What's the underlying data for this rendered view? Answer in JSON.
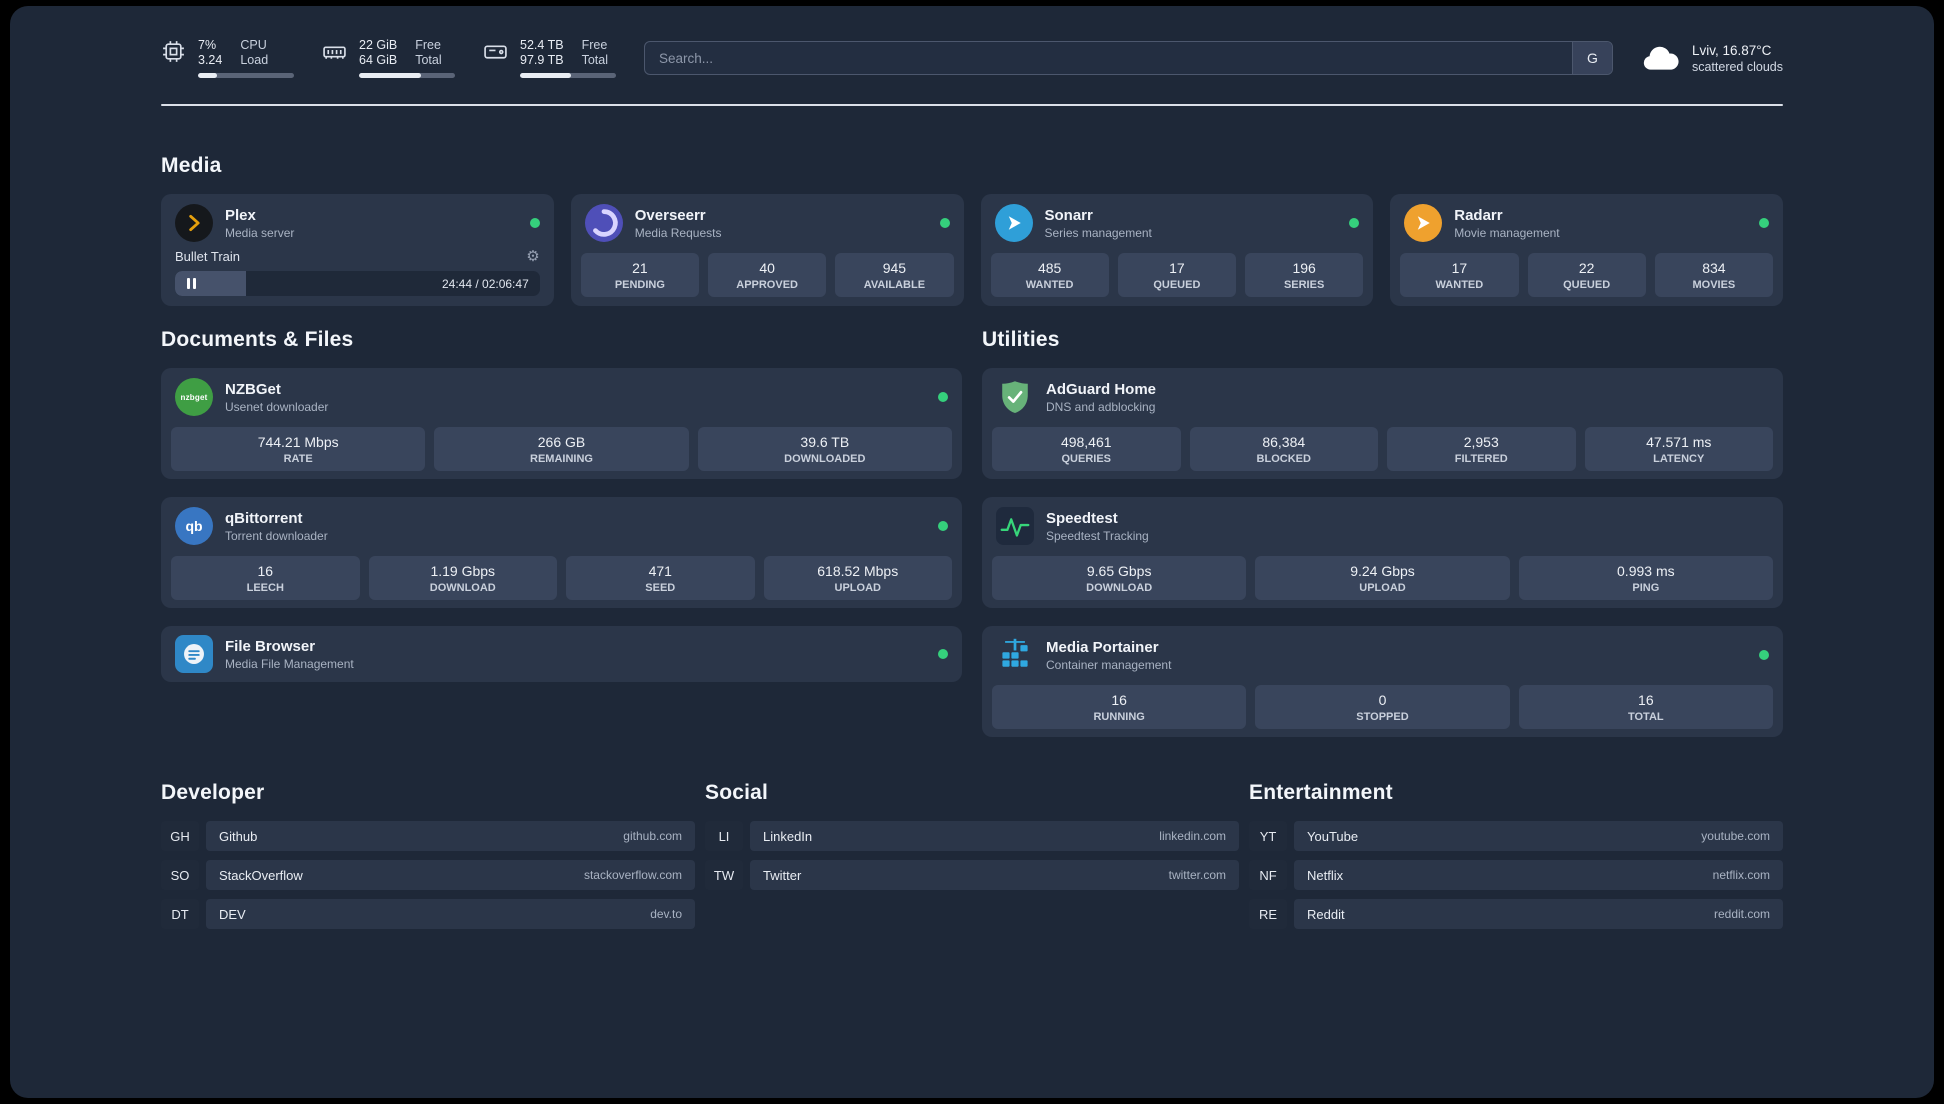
{
  "colors": {
    "status_green": "#35d07c",
    "plex_amber": "#e5a00d",
    "accent_blue": "#2fa8e0"
  },
  "topbar": {
    "cpu": {
      "usage": "7%",
      "load": "3.24",
      "label_top": "CPU",
      "label_bottom": "Load",
      "bar_percent": 20
    },
    "memory": {
      "free": "22 GiB",
      "total": "64 GiB",
      "label_top": "Free",
      "label_bottom": "Total",
      "bar_percent": 65
    },
    "disk": {
      "free": "52.4 TB",
      "total": "97.9 TB",
      "label_top": "Free",
      "label_bottom": "Total",
      "bar_percent": 53
    },
    "search": {
      "placeholder": "Search...",
      "button_label": "G"
    },
    "weather": {
      "location": "Lviv, 16.87°C",
      "condition": "scattered clouds"
    }
  },
  "media": {
    "title": "Media",
    "plex": {
      "name": "Plex",
      "subtitle": "Media server",
      "player": {
        "track_title": "Bullet Train",
        "time": "24:44 / 02:06:47",
        "progress_percent": 19.5
      }
    },
    "overseerr": {
      "name": "Overseerr",
      "subtitle": "Media Requests",
      "stats": [
        {
          "value": "21",
          "label": "PENDING"
        },
        {
          "value": "40",
          "label": "APPROVED"
        },
        {
          "value": "945",
          "label": "AVAILABLE"
        }
      ]
    },
    "sonarr": {
      "name": "Sonarr",
      "subtitle": "Series management",
      "stats": [
        {
          "value": "485",
          "label": "WANTED"
        },
        {
          "value": "17",
          "label": "QUEUED"
        },
        {
          "value": "196",
          "label": "SERIES"
        }
      ]
    },
    "radarr": {
      "name": "Radarr",
      "subtitle": "Movie management",
      "stats": [
        {
          "value": "17",
          "label": "WANTED"
        },
        {
          "value": "22",
          "label": "QUEUED"
        },
        {
          "value": "834",
          "label": "MOVIES"
        }
      ]
    }
  },
  "documents": {
    "title": "Documents & Files",
    "nzbget": {
      "name": "NZBGet",
      "subtitle": "Usenet downloader",
      "icon_text": "nzbget",
      "stats": [
        {
          "value": "744.21 Mbps",
          "label": "RATE"
        },
        {
          "value": "266 GB",
          "label": "REMAINING"
        },
        {
          "value": "39.6 TB",
          "label": "DOWNLOADED"
        }
      ]
    },
    "qbittorrent": {
      "name": "qBittorrent",
      "subtitle": "Torrent downloader",
      "icon_text": "qb",
      "stats": [
        {
          "value": "16",
          "label": "LEECH"
        },
        {
          "value": "1.19 Gbps",
          "label": "DOWNLOAD"
        },
        {
          "value": "471",
          "label": "SEED"
        },
        {
          "value": "618.52 Mbps",
          "label": "UPLOAD"
        }
      ]
    },
    "filebrowser": {
      "name": "File Browser",
      "subtitle": "Media File Management"
    }
  },
  "utilities": {
    "title": "Utilities",
    "adguard": {
      "name": "AdGuard Home",
      "subtitle": "DNS and adblocking",
      "stats": [
        {
          "value": "498,461",
          "label": "QUERIES"
        },
        {
          "value": "86,384",
          "label": "BLOCKED"
        },
        {
          "value": "2,953",
          "label": "FILTERED"
        },
        {
          "value": "47.571 ms",
          "label": "LATENCY"
        }
      ]
    },
    "speedtest": {
      "name": "Speedtest",
      "subtitle": "Speedtest Tracking",
      "stats": [
        {
          "value": "9.65 Gbps",
          "label": "DOWNLOAD"
        },
        {
          "value": "9.24 Gbps",
          "label": "UPLOAD"
        },
        {
          "value": "0.993 ms",
          "label": "PING"
        }
      ]
    },
    "portainer": {
      "name": "Media Portainer",
      "subtitle": "Container management",
      "stats": [
        {
          "value": "16",
          "label": "RUNNING"
        },
        {
          "value": "0",
          "label": "STOPPED"
        },
        {
          "value": "16",
          "label": "TOTAL"
        }
      ]
    }
  },
  "links": {
    "developer": {
      "title": "Developer",
      "items": [
        {
          "badge": "GH",
          "name": "Github",
          "url": "github.com"
        },
        {
          "badge": "SO",
          "name": "StackOverflow",
          "url": "stackoverflow.com"
        },
        {
          "badge": "DT",
          "name": "DEV",
          "url": "dev.to"
        }
      ]
    },
    "social": {
      "title": "Social",
      "items": [
        {
          "badge": "LI",
          "name": "LinkedIn",
          "url": "linkedin.com"
        },
        {
          "badge": "TW",
          "name": "Twitter",
          "url": "twitter.com"
        }
      ]
    },
    "entertainment": {
      "title": "Entertainment",
      "items": [
        {
          "badge": "YT",
          "name": "YouTube",
          "url": "youtube.com"
        },
        {
          "badge": "NF",
          "name": "Netflix",
          "url": "netflix.com"
        },
        {
          "badge": "RE",
          "name": "Reddit",
          "url": "reddit.com"
        }
      ]
    }
  }
}
